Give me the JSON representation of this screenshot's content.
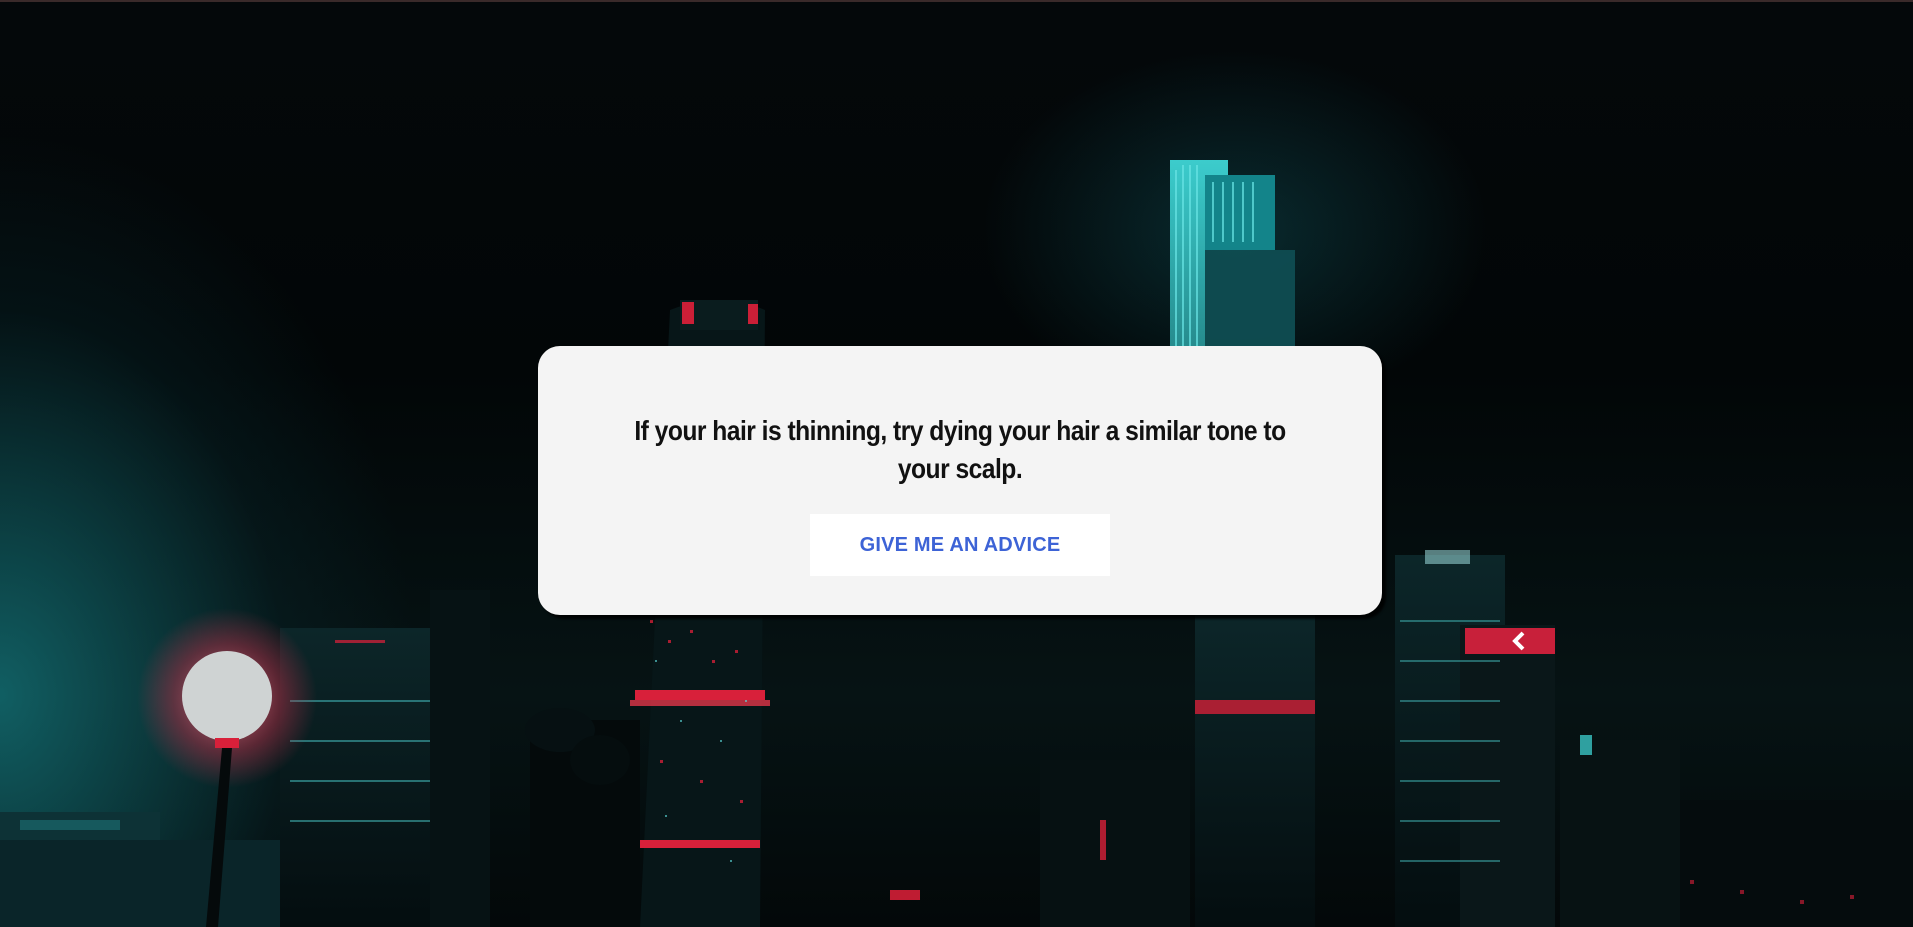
{
  "advice": {
    "text": "If your hair is thinning, try dying your hair a similar tone to your scalp."
  },
  "button": {
    "label": "GIVE ME AN ADVICE"
  },
  "colors": {
    "card_background": "#f4f4f4",
    "button_text": "#3d63d6",
    "page_background": "#03080a",
    "neon_teal": "#19a6a8",
    "neon_red": "#e0203a"
  },
  "background": {
    "icon": "night-city-skyline-photo"
  }
}
